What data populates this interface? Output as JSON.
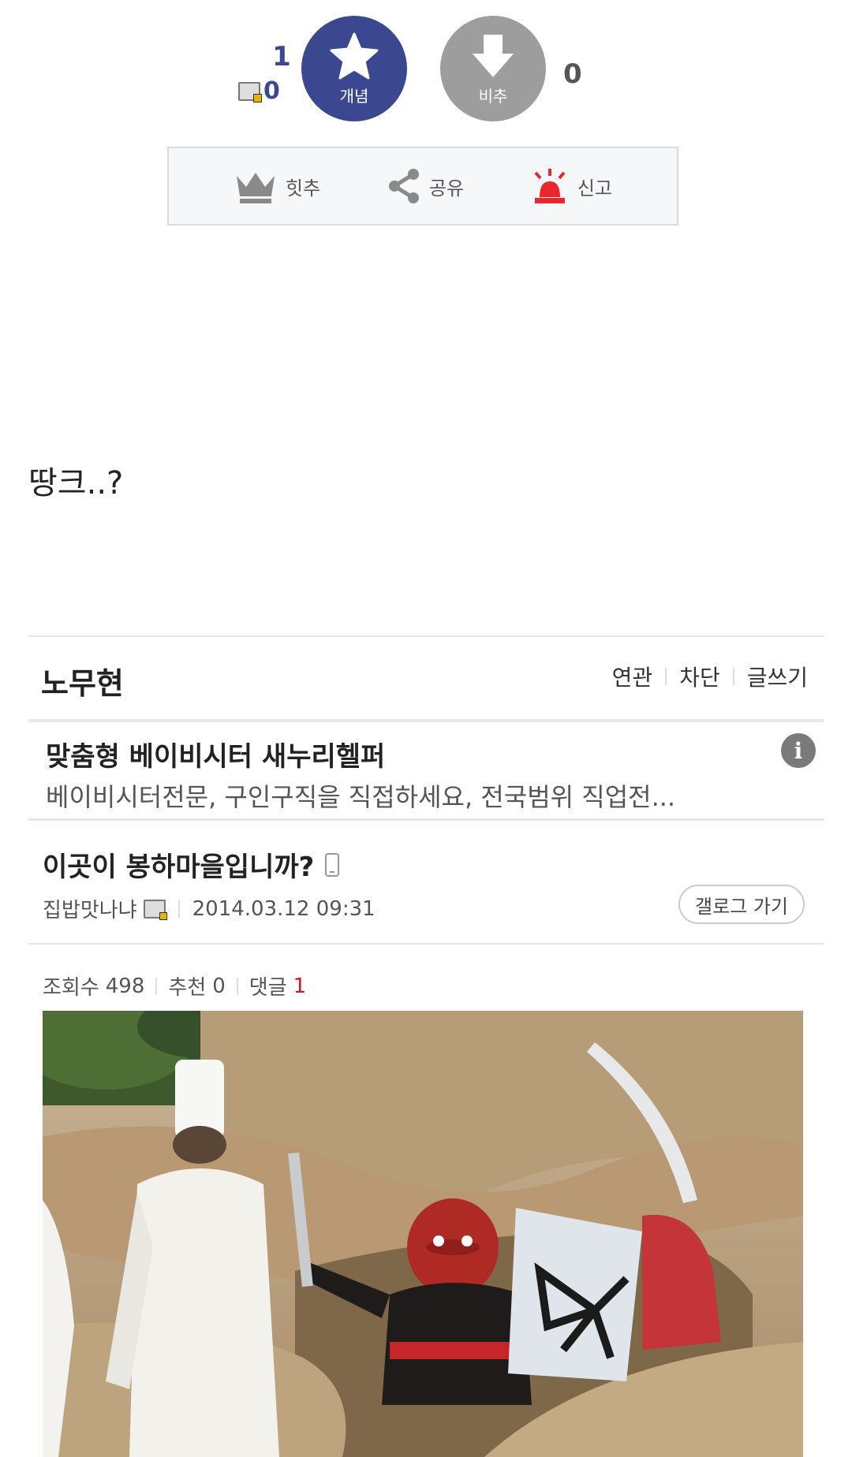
{
  "vote": {
    "up_count": "1",
    "mobile_count": "0",
    "up_label": "개념",
    "down_label": "비추",
    "down_count": "0"
  },
  "actions": {
    "hit": "힛추",
    "share": "공유",
    "report": "신고"
  },
  "post_body": "땅크..?",
  "gallery": {
    "title": "노무현",
    "links": [
      "연관",
      "차단",
      "글쓰기"
    ]
  },
  "ad": {
    "title": "맞춤형 베이비시터 새누리헬퍼",
    "description": "베이비시터전문, 구인구직을 직접하세요, 전국범위 직업전..."
  },
  "related_post": {
    "title": "이곳이 봉하마을입니까?",
    "author": "집밥맛나냐",
    "date": "2014.03.12 09:31",
    "gallog_button": "갤로그 가기"
  },
  "stats": {
    "views_label": "조회수",
    "views": "498",
    "recommend_label": "추천",
    "recommend": "0",
    "comments_label": "댓글",
    "comments": "1"
  },
  "colors": {
    "upvote": "#3b4890",
    "downvote": "#9d9d9d",
    "report": "#e8262c",
    "comment_count": "#d2161e"
  }
}
